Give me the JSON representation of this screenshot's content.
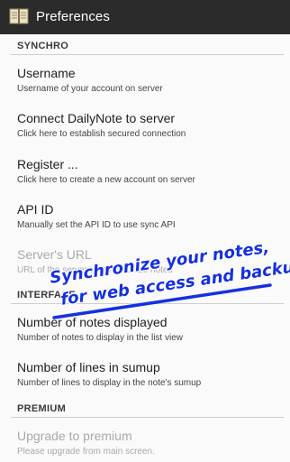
{
  "actionbar": {
    "title": "Preferences",
    "icon": "book-icon"
  },
  "sections": [
    {
      "header": "SYNCHRO",
      "items": [
        {
          "title": "Username",
          "summary": "Username of your account on server",
          "enabled": true
        },
        {
          "title": "Connect DailyNote to server",
          "summary": "Click here to establish secured connection",
          "enabled": true
        },
        {
          "title": "Register ...",
          "summary": "Click here to create a new account on server",
          "enabled": true
        },
        {
          "title": "API ID",
          "summary": "Manually set the API ID to use sync API",
          "enabled": true
        },
        {
          "title": "Server's URL",
          "summary": "URL of the server to synchronize notes",
          "enabled": false
        }
      ]
    },
    {
      "header": "INTERFACE",
      "items": [
        {
          "title": "Number of notes displayed",
          "summary": "Number of notes to display in the list view",
          "enabled": true
        },
        {
          "title": "Number of lines in sumup",
          "summary": "Number of lines to display in the note's sumup",
          "enabled": true
        }
      ]
    },
    {
      "header": "PREMIUM",
      "items": [
        {
          "title": "Upgrade to premium",
          "summary": "Please upgrade from main screen.",
          "enabled": false
        }
      ]
    }
  ],
  "promo": {
    "line1": "Synchronize your notes,",
    "line2": "for web access and backup !",
    "color": "#1530e0"
  },
  "colors": {
    "actionbar": "#2b2b2b",
    "background": "#fafafa",
    "disabled_text": "#a9a9a9"
  }
}
